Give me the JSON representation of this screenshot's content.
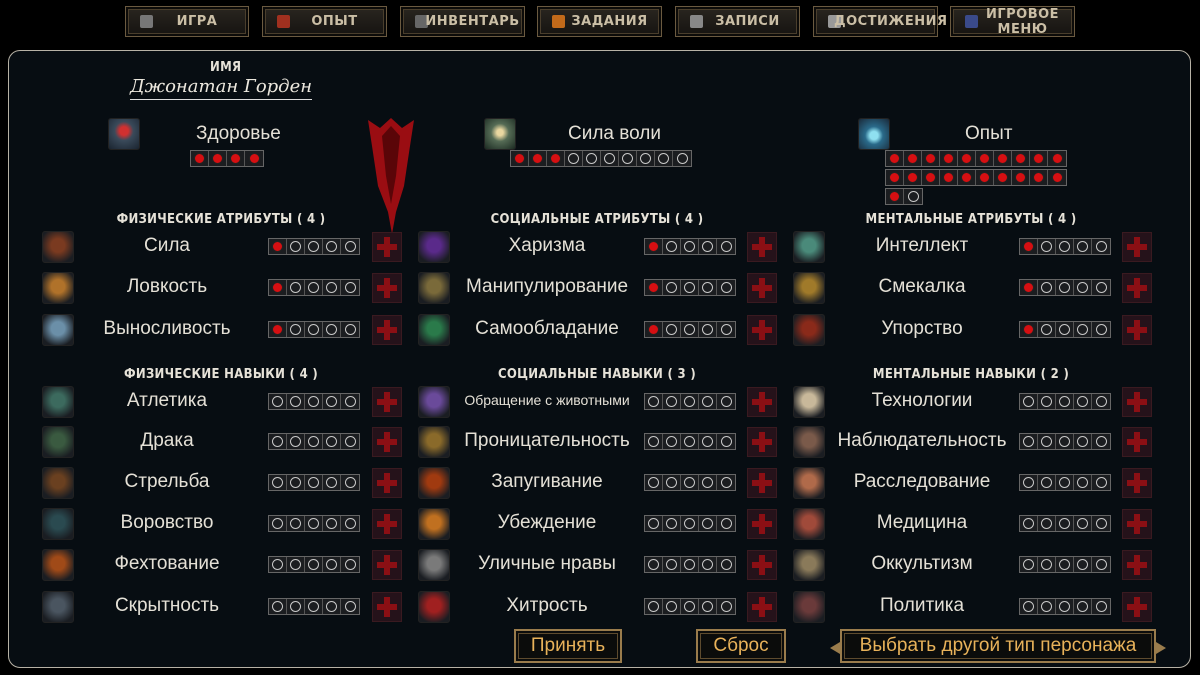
{
  "nav": [
    {
      "label": "ИГРА",
      "icon": "game-icon",
      "color": "#777"
    },
    {
      "label": "ОПЫТ",
      "icon": "plus-icon",
      "color": "#a0301f"
    },
    {
      "label": "ИНВЕНТАРЬ",
      "icon": "inventory-icon",
      "color": "#666"
    },
    {
      "label": "ЗАДАНИЯ",
      "icon": "quest-icon",
      "color": "#c26a1a"
    },
    {
      "label": "ЗАПИСИ",
      "icon": "notes-icon",
      "color": "#888"
    },
    {
      "label": "ДОСТИЖЕНИЯ",
      "icon": "trophy-icon",
      "color": "#999"
    },
    {
      "label": "ИГРОВОЕ МЕНЮ",
      "icon": "menu-icon",
      "color": "#3a4a8a"
    }
  ],
  "character": {
    "name_label": "ИМЯ",
    "name": "Джонатан Горден"
  },
  "stats": {
    "health": {
      "label": "Здоровье",
      "filled": 4,
      "total": 4
    },
    "willpower": {
      "label": "Сила воли",
      "filled": 3,
      "total": 10
    },
    "experience": {
      "label": "Опыт",
      "filled": 21,
      "total": 22
    }
  },
  "columns": [
    {
      "attributes_title": "ФИЗИЧЕСКИЕ АТРИБУТЫ ( 4 )",
      "skills_title": "ФИЗИЧЕСКИЕ НАВЫКИ ( 4 )",
      "attributes": [
        {
          "label": "Сила",
          "filled": 1,
          "icon": "strength-icon",
          "color": "#7a3a20"
        },
        {
          "label": "Ловкость",
          "filled": 1,
          "icon": "gear-eye-icon",
          "color": "#b0722a"
        },
        {
          "label": "Выносливость",
          "filled": 1,
          "icon": "stone-face-icon",
          "color": "#6b8fa8"
        }
      ],
      "skills": [
        {
          "label": "Атлетика",
          "filled": 0,
          "icon": "boot-icon",
          "color": "#3c6a5e"
        },
        {
          "label": "Драка",
          "filled": 0,
          "icon": "fighter-icon",
          "color": "#3a5a40"
        },
        {
          "label": "Стрельба",
          "filled": 0,
          "icon": "gun-icon",
          "color": "#6a4020"
        },
        {
          "label": "Воровство",
          "filled": 0,
          "icon": "thief-icon",
          "color": "#2a4a50"
        },
        {
          "label": "Фехтование",
          "filled": 0,
          "icon": "sword-icon",
          "color": "#a04a18"
        },
        {
          "label": "Скрытность",
          "filled": 0,
          "icon": "hood-icon",
          "color": "#4a5560"
        }
      ]
    },
    {
      "attributes_title": "СОЦИАЛЬНЫЕ АТРИБУТЫ ( 4 )",
      "skills_title": "СОЦИАЛЬНЫЕ НАВЫКИ ( 3 )",
      "attributes": [
        {
          "label": "Харизма",
          "filled": 1,
          "icon": "charisma-orb-icon",
          "color": "#5a2a8a"
        },
        {
          "label": "Манипулирование",
          "filled": 1,
          "icon": "hooded-figure-icon",
          "color": "#7a6a3a"
        },
        {
          "label": "Самообладание",
          "filled": 1,
          "icon": "leaf-icon",
          "color": "#2a7a4a"
        }
      ],
      "skills": [
        {
          "label": "Обращение с животными",
          "filled": 0,
          "icon": "animal-icon",
          "color": "#6a4a9a"
        },
        {
          "label": "Проницательность",
          "filled": 0,
          "icon": "eye-orb-icon",
          "color": "#8a6a2a"
        },
        {
          "label": "Запугивание",
          "filled": 0,
          "icon": "fire-figure-icon",
          "color": "#a03a10"
        },
        {
          "label": "Убеждение",
          "filled": 0,
          "icon": "eye-pattern-icon",
          "color": "#c07020"
        },
        {
          "label": "Уличные нравы",
          "filled": 0,
          "icon": "mask-icon",
          "color": "#7a7a7a"
        },
        {
          "label": "Хитрость",
          "filled": 0,
          "icon": "demon-icon",
          "color": "#a02020"
        }
      ]
    },
    {
      "attributes_title": "МЕНТАЛЬНЫЕ АТРИБУТЫ ( 4 )",
      "skills_title": "МЕНТАЛЬНЫЕ НАВЫКИ ( 2 )",
      "attributes": [
        {
          "label": "Интеллект",
          "filled": 1,
          "icon": "mind-icon",
          "color": "#4a8a7a"
        },
        {
          "label": "Смекалка",
          "filled": 1,
          "icon": "bulb-icon",
          "color": "#a07a2a"
        },
        {
          "label": "Упорство",
          "filled": 1,
          "icon": "flame-head-icon",
          "color": "#8a2a1a"
        }
      ],
      "skills": [
        {
          "label": "Технологии",
          "filled": 0,
          "icon": "computer-icon",
          "color": "#c8b89a"
        },
        {
          "label": "Наблюдательность",
          "filled": 0,
          "icon": "shield-eye-icon",
          "color": "#7a5a4a"
        },
        {
          "label": "Расследование",
          "filled": 0,
          "icon": "eye-icon",
          "color": "#b06a4a"
        },
        {
          "label": "Медицина",
          "filled": 0,
          "icon": "heart-hand-icon",
          "color": "#a04a3a"
        },
        {
          "label": "Оккультизм",
          "filled": 0,
          "icon": "hand-icon",
          "color": "#8a7a5a"
        },
        {
          "label": "Политика",
          "filled": 0,
          "icon": "teeth-icon",
          "color": "#6a3a3a"
        }
      ]
    }
  ],
  "actions": {
    "accept": "Принять",
    "reset": "Сброс",
    "change_type": "Выбрать другой тип персонажа"
  }
}
